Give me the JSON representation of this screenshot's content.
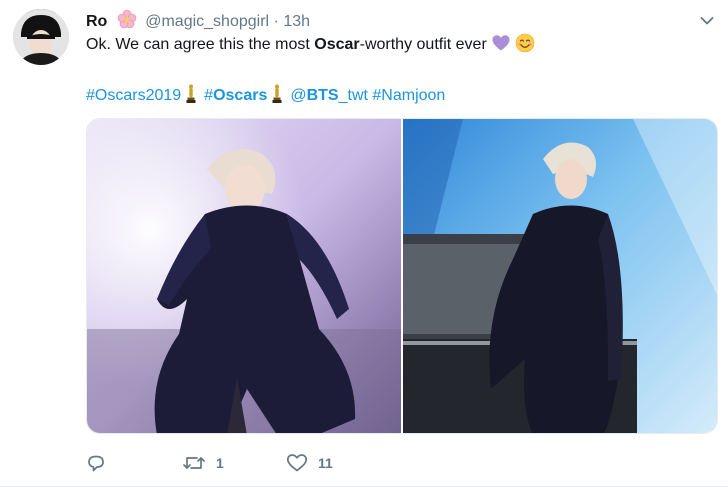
{
  "tweet": {
    "author_name": "Ro",
    "handle": "@magic_shopgirl",
    "separator": "·",
    "time": "13h",
    "text_before": "Ok. We can agree this the most ",
    "text_bold": "Oscar",
    "text_after": "-worthy outfit ever",
    "hashtags": [
      {
        "text": "#Oscars2019"
      },
      {
        "text": "#Oscars"
      },
      {
        "text": "@BTS_twt"
      },
      {
        "text": "#Namjoon"
      }
    ],
    "media_count": 2,
    "reply_count": "",
    "retweet_count": "1",
    "like_count": "11"
  },
  "icons": {
    "author_badge": "cherry-blossom-icon",
    "caret": "chevron-down-icon",
    "reply": "reply-icon",
    "retweet": "retweet-icon",
    "like": "heart-icon",
    "emoji_1": "purple-heart-icon",
    "emoji_2": "smiling-face-icon",
    "trophy": "oscar-statue-icon"
  },
  "colors": {
    "link": "#1b95e0",
    "secondary": "#657786",
    "text": "#14171a",
    "divider": "#e6ecf0"
  }
}
